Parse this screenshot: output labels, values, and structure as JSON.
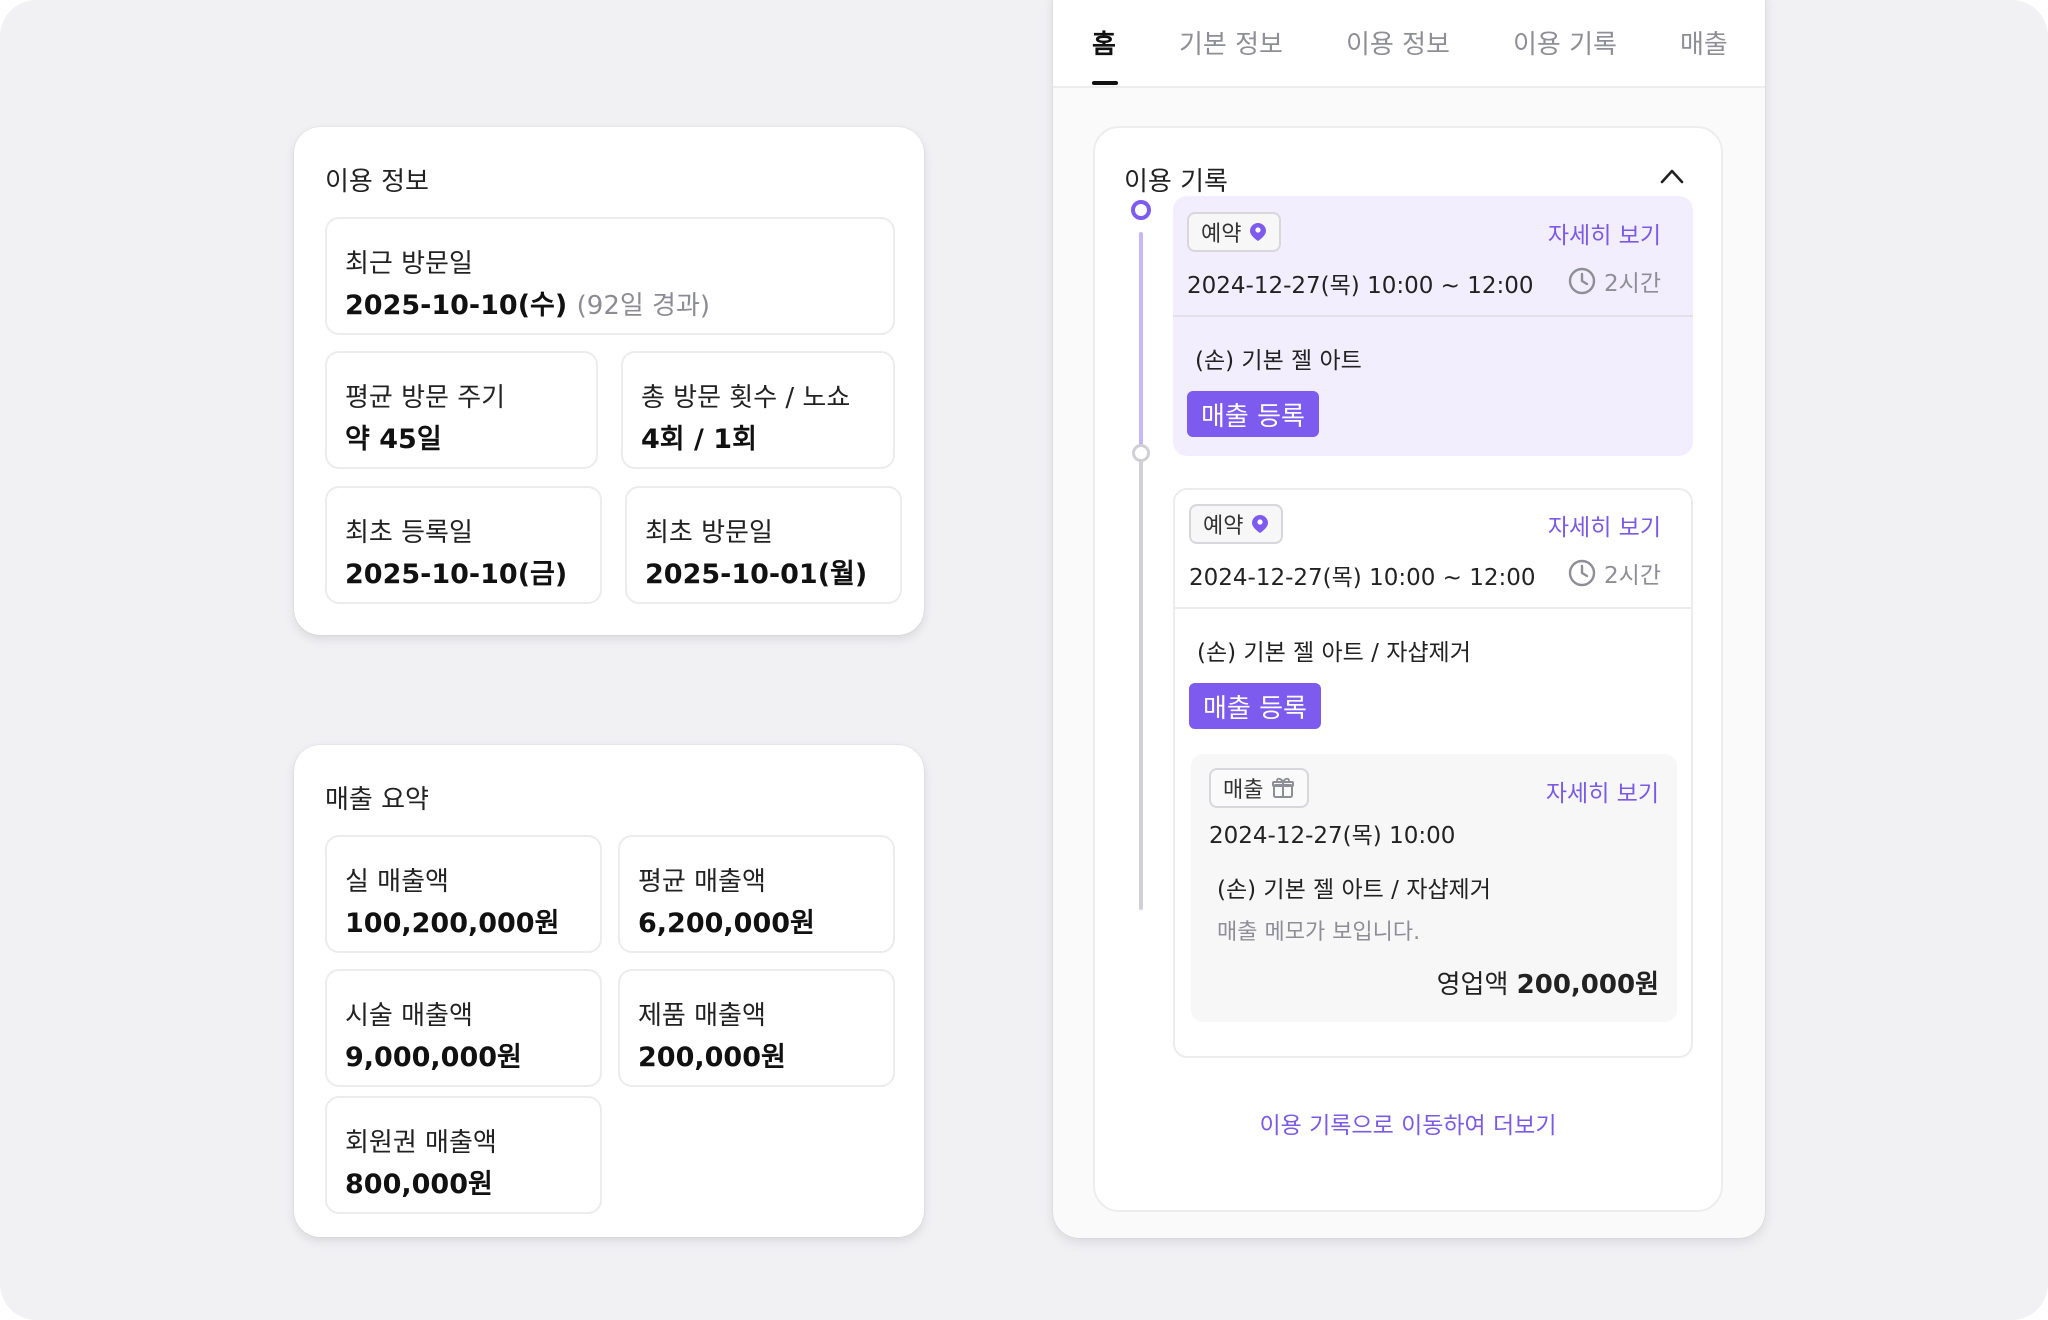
{
  "colors": {
    "accent": "#7e5bef",
    "accent_light": "#f3eefe",
    "background": "#f1f1f4"
  },
  "usage_info": {
    "title": "이용 정보",
    "recent_visit": {
      "label": "최근 방문일",
      "value": "2025-10-10(수)",
      "sub": "(92일 경과)"
    },
    "avg_cycle": {
      "label": "평균 방문 주기",
      "value": "약 45일"
    },
    "total_visits": {
      "label": "총 방문 횟수 / 노쇼",
      "value": "4회 / 1회"
    },
    "first_registered": {
      "label": "최초 등록일",
      "value": "2025-10-10(금)"
    },
    "first_visit": {
      "label": "최초 방문일",
      "value": "2025-10-01(월)"
    }
  },
  "sales_summary": {
    "title": "매출 요약",
    "net_sales": {
      "label": "실 매출액",
      "value": "100,200,000원"
    },
    "avg_sales": {
      "label": "평균 매출액",
      "value": "6,200,000원"
    },
    "treatment_sales": {
      "label": "시술 매출액",
      "value": "9,000,000원"
    },
    "product_sales": {
      "label": "제품 매출액",
      "value": "200,000원"
    },
    "membership_sales": {
      "label": "회원권 매출액",
      "value": "800,000원"
    }
  },
  "tabs": [
    "홈",
    "기본 정보",
    "이용 정보",
    "이용 기록",
    "매출"
  ],
  "history": {
    "title": "이용 기록",
    "records": [
      {
        "badge": "예약",
        "badge_icon": "pin-icon",
        "detail_link": "자세히 보기",
        "datetime": "2024-12-27(목) 10:00 ~ 12:00",
        "duration": "2시간",
        "service": "(손) 기본 젤 아트",
        "button": "매출 등록"
      },
      {
        "badge": "예약",
        "badge_icon": "pin-icon",
        "detail_link": "자세히 보기",
        "datetime": "2024-12-27(목) 10:00 ~ 12:00",
        "duration": "2시간",
        "service": "(손) 기본 젤 아트 / 자샵제거",
        "button": "매출 등록",
        "sale": {
          "badge": "매출",
          "badge_icon": "gift-icon",
          "detail_link": "자세히 보기",
          "datetime": "2024-12-27(목) 10:00",
          "service": "(손) 기본 젤 아트 / 자샵제거",
          "memo": "매출 메모가 보입니다.",
          "amount_label": "영업액",
          "amount": "200,000원"
        }
      }
    ],
    "more_link": "이용 기록으로 이동하여 더보기"
  }
}
